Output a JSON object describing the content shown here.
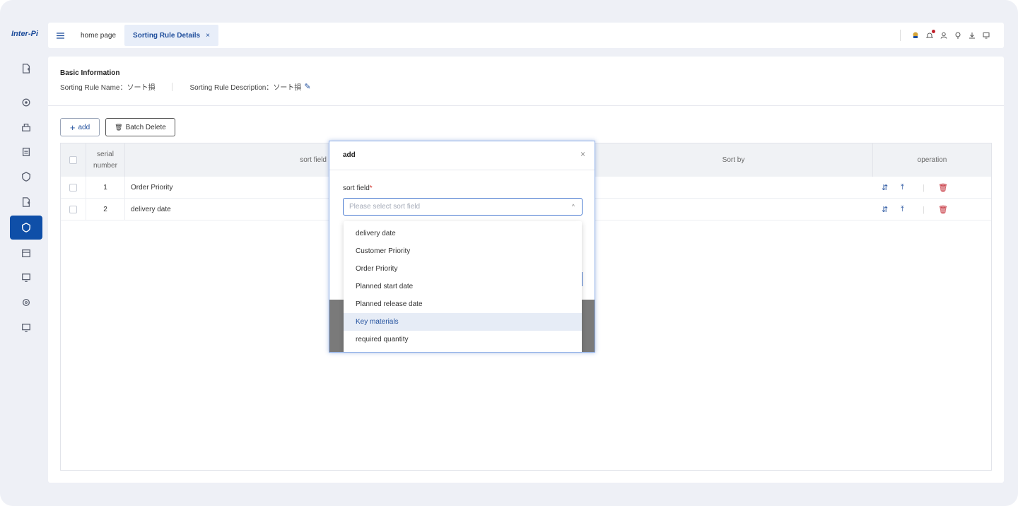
{
  "app": {
    "logo": "Inter-Pi"
  },
  "topbar": {
    "tabs": [
      {
        "label": "home page",
        "active": false
      },
      {
        "label": "Sorting Rule Details",
        "active": true,
        "close": "×"
      }
    ],
    "icons": [
      "avatar-badge-icon",
      "bell-icon",
      "user-icon",
      "pin-icon",
      "download-icon",
      "monitor-icon"
    ],
    "notification_dot_color": "#c0212c"
  },
  "sidebar": {
    "items": [
      "file-icon",
      "gear-icon",
      "box-icon",
      "clipboard-icon",
      "shield-icon",
      "file-icon",
      "shield-icon",
      "calendar-icon",
      "monitor-icon",
      "settings-icon",
      "monitor-icon"
    ],
    "active_index": 6,
    "accent": "#0f4fa8"
  },
  "basic": {
    "title": "Basic Information",
    "name_label": "Sorting Rule Name：",
    "name_value": "ソート損",
    "desc_label": "Sorting Rule Description：",
    "desc_value": "ソート損"
  },
  "toolbar": {
    "add_label": "add",
    "batch_delete_label": "Batch Delete"
  },
  "table": {
    "headers": {
      "serial": "serial number",
      "sort_field": "sort field",
      "sort_by": "Sort by",
      "operation": "operation"
    },
    "rows": [
      {
        "serial": "1",
        "field": "Order Priority"
      },
      {
        "serial": "2",
        "field": "delivery date"
      }
    ],
    "op_icons": [
      "sort-icon",
      "pin-top-icon",
      "delete-icon"
    ],
    "delete_color": "#c0212c"
  },
  "modal": {
    "title": "add",
    "close": "×",
    "field_label": "sort field",
    "required_mark": "*",
    "placeholder": "Please select sort field",
    "caret": "^",
    "options": [
      "delivery date",
      "Customer Priority",
      "Order Priority",
      "Planned start date",
      "Planned release date",
      "Key materials",
      "required quantity"
    ],
    "highlighted_option": "Key materials"
  }
}
